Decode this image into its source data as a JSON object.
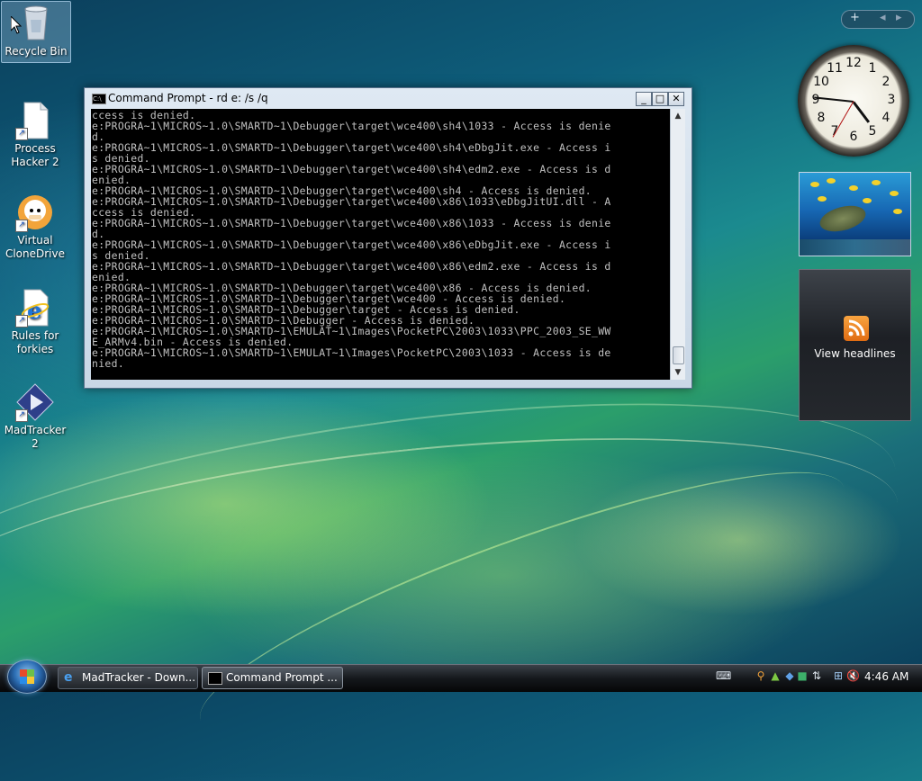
{
  "desktop": {
    "icons": [
      {
        "label": "Recycle Bin"
      },
      {
        "label": "Process Hacker 2"
      },
      {
        "label": "Virtual CloneDrive"
      },
      {
        "label": "Rules for forkies"
      },
      {
        "label": "MadTracker 2"
      }
    ]
  },
  "cmd_window": {
    "title": "Command Prompt - rd  e: /s /q",
    "icon_text": "C:\\",
    "buttons": {
      "minimize": "_",
      "maximize": "□",
      "close": "✕"
    },
    "console_text": "ccess is denied.\ne:PROGRA~1\\MICROS~1.0\\SMARTD~1\\Debugger\\target\\wce400\\sh4\\1033 - Access is denie\nd.\ne:PROGRA~1\\MICROS~1.0\\SMARTD~1\\Debugger\\target\\wce400\\sh4\\eDbgJit.exe - Access i\ns denied.\ne:PROGRA~1\\MICROS~1.0\\SMARTD~1\\Debugger\\target\\wce400\\sh4\\edm2.exe - Access is d\nenied.\ne:PROGRA~1\\MICROS~1.0\\SMARTD~1\\Debugger\\target\\wce400\\sh4 - Access is denied.\ne:PROGRA~1\\MICROS~1.0\\SMARTD~1\\Debugger\\target\\wce400\\x86\\1033\\eDbgJitUI.dll - A\nccess is denied.\ne:PROGRA~1\\MICROS~1.0\\SMARTD~1\\Debugger\\target\\wce400\\x86\\1033 - Access is denie\nd.\ne:PROGRA~1\\MICROS~1.0\\SMARTD~1\\Debugger\\target\\wce400\\x86\\eDbgJit.exe - Access i\ns denied.\ne:PROGRA~1\\MICROS~1.0\\SMARTD~1\\Debugger\\target\\wce400\\x86\\edm2.exe - Access is d\nenied.\ne:PROGRA~1\\MICROS~1.0\\SMARTD~1\\Debugger\\target\\wce400\\x86 - Access is denied.\ne:PROGRA~1\\MICROS~1.0\\SMARTD~1\\Debugger\\target\\wce400 - Access is denied.\ne:PROGRA~1\\MICROS~1.0\\SMARTD~1\\Debugger\\target - Access is denied.\ne:PROGRA~1\\MICROS~1.0\\SMARTD~1\\Debugger - Access is denied.\ne:PROGRA~1\\MICROS~1.0\\SMARTD~1\\EMULAT~1\\Images\\PocketPC\\2003\\1033\\PPC_2003_SE_WW\nE_ARMv4.bin - Access is denied.\ne:PROGRA~1\\MICROS~1.0\\SMARTD~1\\EMULAT~1\\Images\\PocketPC\\2003\\1033 - Access is de\nnied."
  },
  "sidebar": {
    "controls": {
      "add": "+",
      "prev": "◂",
      "next": "▸"
    },
    "clock": {
      "numbers": [
        "12",
        "1",
        "2",
        "3",
        "4",
        "5",
        "6",
        "7",
        "8",
        "9",
        "10",
        "11"
      ]
    },
    "feeds": {
      "label": "View headlines"
    }
  },
  "taskbar": {
    "buttons": [
      {
        "label": "MadTracker - Down..."
      },
      {
        "label": "Command Prompt ..."
      }
    ],
    "time": "4:46 AM"
  },
  "colors": {
    "console_bg": "#000000",
    "console_fg": "#c0c0c0",
    "rss_orange": "#f28a24"
  }
}
